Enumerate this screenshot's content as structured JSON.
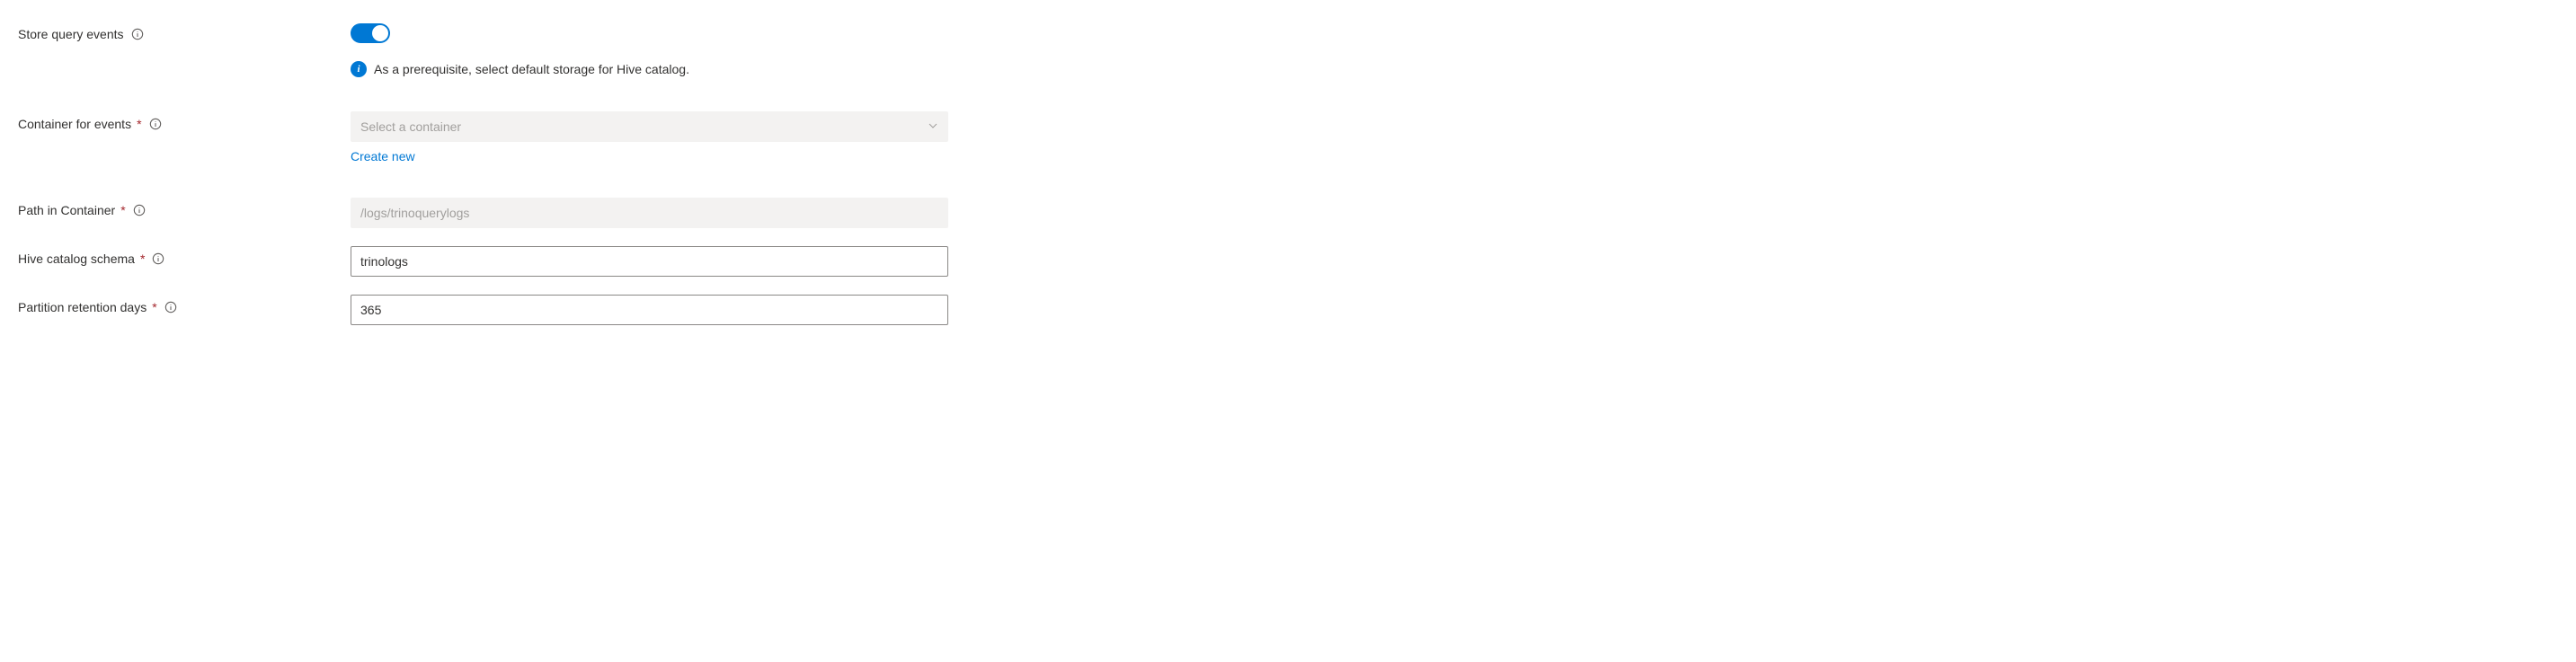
{
  "rows": {
    "store_query_events": {
      "label": "Store query events",
      "toggle_on": true,
      "info_message": "As a prerequisite, select default storage for Hive catalog."
    },
    "container_for_events": {
      "label": "Container for events",
      "required_mark": "*",
      "placeholder": "Select a container",
      "create_new": "Create new"
    },
    "path_in_container": {
      "label": "Path in Container",
      "required_mark": "*",
      "placeholder": "/logs/trinoquerylogs",
      "value": ""
    },
    "hive_catalog_schema": {
      "label": "Hive catalog schema",
      "required_mark": "*",
      "value": "trinologs"
    },
    "partition_retention_days": {
      "label": "Partition retention days",
      "required_mark": "*",
      "value": "365"
    }
  }
}
